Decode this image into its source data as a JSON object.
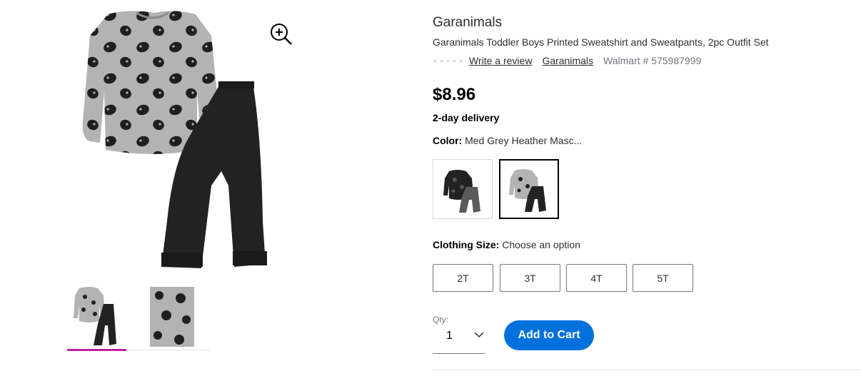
{
  "product": {
    "brand": "Garanimals",
    "title": "Garanimals Toddler Boys Printed Sweatshirt and Sweatpants, 2pc Outfit Set",
    "write_review": "Write a review",
    "brand_link": "Garanimals",
    "walmart_number": "Walmart # 575987999",
    "price": "$8.96",
    "delivery": "2-day delivery",
    "rating_stars": 0
  },
  "color": {
    "label": "Color:",
    "selected": "Med Grey Heather Masc..."
  },
  "size": {
    "label": "Clothing Size:",
    "selected": "Choose an option",
    "options": [
      "2T",
      "3T",
      "4T",
      "5T"
    ]
  },
  "quantity": {
    "label": "Qty:",
    "value": "1"
  },
  "cart": {
    "label": "Add to Cart"
  },
  "colors": {
    "accent": "#0071dc",
    "thumb_active": "#c1209f",
    "sweatshirt": "#b3b3b3",
    "pants": "#222222"
  }
}
